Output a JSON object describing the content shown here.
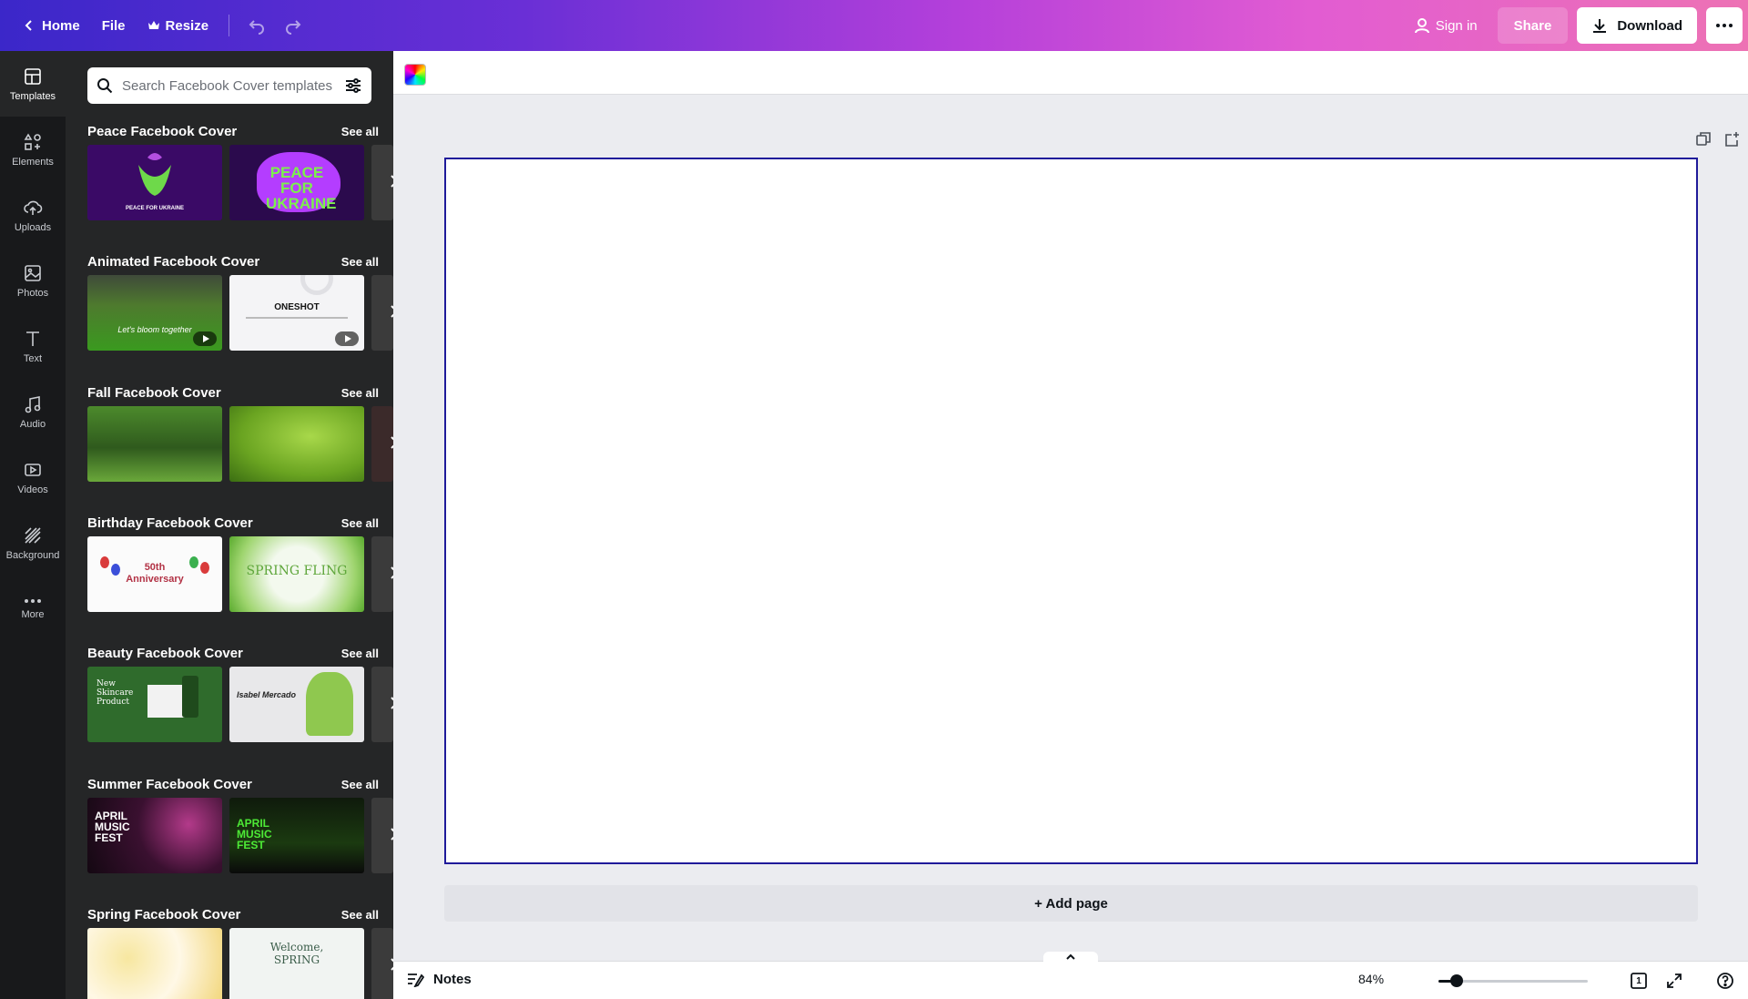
{
  "topbar": {
    "home_label": "Home",
    "file_label": "File",
    "resize_label": "Resize",
    "sign_in_label": "Sign in",
    "share_label": "Share",
    "download_label": "Download"
  },
  "rail": {
    "items": [
      {
        "label": "Templates",
        "icon": "templates-icon",
        "active": true
      },
      {
        "label": "Elements",
        "icon": "elements-icon"
      },
      {
        "label": "Uploads",
        "icon": "upload-cloud-icon"
      },
      {
        "label": "Photos",
        "icon": "photos-icon"
      },
      {
        "label": "Text",
        "icon": "text-icon"
      },
      {
        "label": "Audio",
        "icon": "music-note-icon"
      },
      {
        "label": "Videos",
        "icon": "video-icon"
      },
      {
        "label": "Background",
        "icon": "background-pattern-icon"
      },
      {
        "label": "More",
        "icon": "more-dots-icon"
      }
    ]
  },
  "panel": {
    "search_placeholder": "Search Facebook Cover templates",
    "see_all_label": "See all",
    "sections": [
      {
        "title": "Peace Facebook Cover",
        "thumb1_text": "PEACE FOR UKRAINE",
        "thumb2_text": "PEACE FOR UKRAINE"
      },
      {
        "title": "Animated Facebook Cover",
        "thumb1_text": "Let's bloom together",
        "thumb2_text": "ONESHOT"
      },
      {
        "title": "Fall Facebook Cover",
        "thumb1_text": "",
        "thumb2_text": ""
      },
      {
        "title": "Birthday Facebook Cover",
        "thumb1_text": "50th Anniversary",
        "thumb2_text": "SPRING FLING"
      },
      {
        "title": "Beauty Facebook Cover",
        "thumb1_text": "New Skincare Product",
        "thumb2_text": "Isabel Mercado"
      },
      {
        "title": "Summer Facebook Cover",
        "thumb1_text": "APRIL MUSIC FEST",
        "thumb2_text": "APRIL MUSIC FEST"
      },
      {
        "title": "Spring Facebook Cover",
        "thumb1_text": "",
        "thumb2_text": "Welcome, SPRING"
      }
    ]
  },
  "canvas": {
    "add_page_label": "+ Add page"
  },
  "bottombar": {
    "notes_label": "Notes",
    "zoom_label": "84%",
    "zoom_fraction": 0.12,
    "page_count": "1"
  },
  "colors": {
    "accent_gradient_start": "#3b27c9",
    "accent_gradient_end": "#ed72b4",
    "rail_bg": "#18191b",
    "panel_bg": "#252627",
    "page_border": "#1f1a9a"
  }
}
